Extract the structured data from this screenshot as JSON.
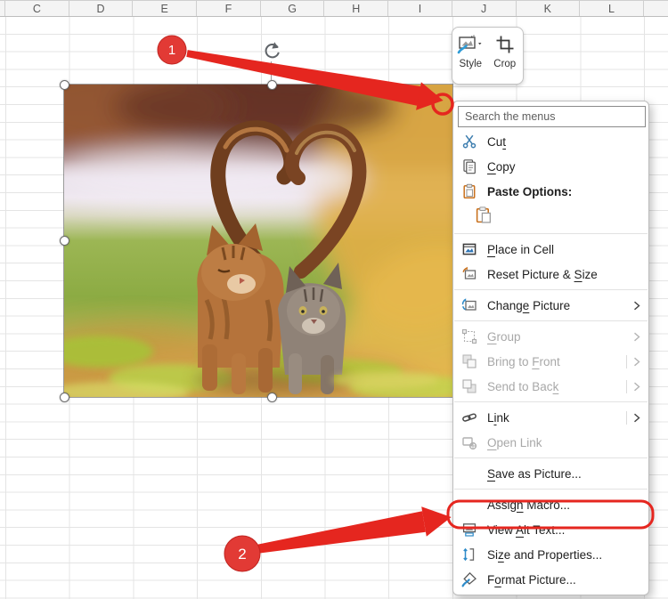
{
  "spreadsheet": {
    "column_headers": [
      "C",
      "D",
      "E",
      "F",
      "G",
      "H",
      "I",
      "J",
      "K",
      "L"
    ]
  },
  "picture": {
    "name": "cats-heart-photo"
  },
  "mini_toolbar": {
    "style_label": "Style",
    "crop_label": "Crop"
  },
  "context_menu": {
    "search_placeholder": "Search the menus",
    "items": [
      {
        "type": "item",
        "name": "cut",
        "label": "Cut",
        "accel": 2,
        "icon": "scissors-icon"
      },
      {
        "type": "item",
        "name": "copy",
        "label": "Copy",
        "accel": 0,
        "icon": "copy-icon"
      },
      {
        "type": "item",
        "name": "paste-options",
        "label": "Paste Options:",
        "bold": true,
        "icon": "clipboard-icon"
      },
      {
        "type": "icon-row",
        "name": "paste-option",
        "icon": "paste-icon"
      },
      {
        "type": "separator"
      },
      {
        "type": "item",
        "name": "place-in-cell",
        "label": "Place in Cell",
        "accel": 0,
        "icon": "place-in-cell-icon"
      },
      {
        "type": "item",
        "name": "reset-picture-size",
        "label": "Reset Picture & Size",
        "accel": 16,
        "icon": "reset-picture-icon"
      },
      {
        "type": "separator"
      },
      {
        "type": "item",
        "name": "change-picture",
        "label": "Change Picture",
        "accel": 5,
        "icon": "change-picture-icon",
        "submenu": "arrow"
      },
      {
        "type": "separator"
      },
      {
        "type": "item",
        "name": "group",
        "label": "Group",
        "accel": 0,
        "icon": "group-icon",
        "disabled": true,
        "submenu": "arrow"
      },
      {
        "type": "item",
        "name": "bring-to-front",
        "label": "Bring to Front",
        "accel": 9,
        "icon": "bring-to-front-icon",
        "disabled": true,
        "submenu": "bar-arrow"
      },
      {
        "type": "item",
        "name": "send-to-back",
        "label": "Send to Back",
        "accel": 11,
        "icon": "send-to-back-icon",
        "disabled": true,
        "submenu": "bar-arrow"
      },
      {
        "type": "separator"
      },
      {
        "type": "item",
        "name": "link",
        "label": "Link",
        "accel": 1,
        "icon": "link-icon",
        "submenu": "bar-arrow"
      },
      {
        "type": "item",
        "name": "open-link",
        "label": "Open Link",
        "accel": 0,
        "icon": "open-link-icon",
        "disabled": true
      },
      {
        "type": "separator"
      },
      {
        "type": "item",
        "name": "save-as-picture",
        "label": "Save as Picture...",
        "accel": 0
      },
      {
        "type": "separator"
      },
      {
        "type": "item",
        "name": "assign-macro",
        "label": "Assign Macro...",
        "accel": 5
      },
      {
        "type": "item",
        "name": "view-alt-text",
        "label": "View Alt Text...",
        "accel": 5,
        "icon": "alt-text-icon",
        "highlighted": true
      },
      {
        "type": "item",
        "name": "size-and-properties",
        "label": "Size and Properties...",
        "accel": 2,
        "icon": "size-properties-icon"
      },
      {
        "type": "item",
        "name": "format-picture",
        "label": "Format Picture...",
        "accel": 1,
        "icon": "format-picture-icon"
      }
    ]
  },
  "annotations": {
    "badge1": "1",
    "badge2": "2",
    "accent_red": "#e5261f",
    "highlighted_item": "View Alt Text..."
  }
}
